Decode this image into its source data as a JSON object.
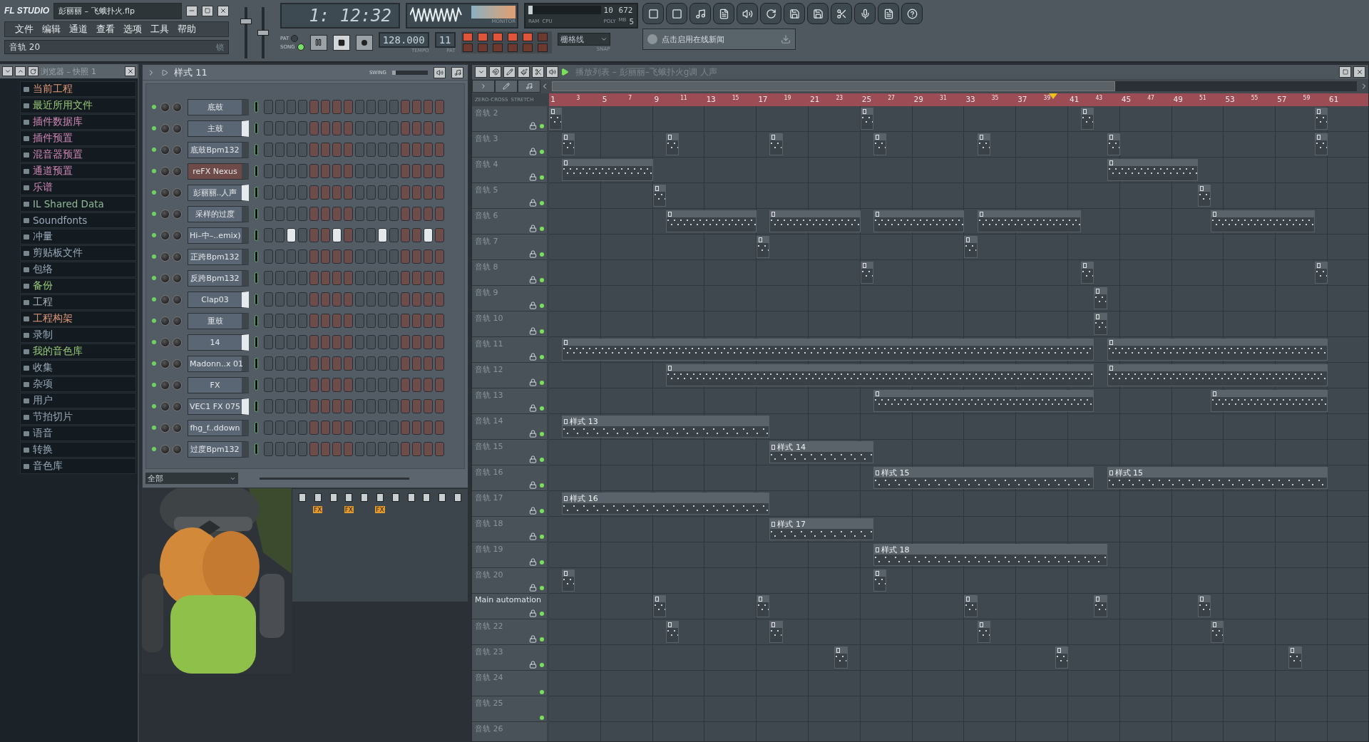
{
  "main_panel": {
    "logo": "FL STUDIO",
    "title": "彭丽丽 – 飞蛾扑火.flp",
    "menu": [
      "文件",
      "编辑",
      "通道",
      "查看",
      "选项",
      "工具",
      "帮助"
    ],
    "hint": "音轨 20",
    "hint_lock": "锁"
  },
  "master": {
    "volume": {
      "level": 0.75
    },
    "pitch": {
      "level": 0.5
    }
  },
  "transport": {
    "time": "1: 12:32",
    "modes": [
      {
        "label": "PAT",
        "selected": false
      },
      {
        "label": "SONG",
        "selected": true
      }
    ],
    "buttons": [
      {
        "kind": "pause",
        "pressed": false
      },
      {
        "kind": "stop",
        "pressed": true
      },
      {
        "kind": "record",
        "pressed": false
      }
    ],
    "tempo": "128.000",
    "tempo_label": "TEMPO",
    "pattern": "11",
    "pattern_label": "PAT"
  },
  "monitor": {
    "label": "MONITOR"
  },
  "cpu": {
    "cpu_value": "10",
    "ram_value": "672",
    "ram_label": "RAM",
    "mb_label": "MB",
    "cpu_label": "CPU",
    "poly_label": "POLY",
    "poly_value": "5"
  },
  "toggles": [
    {
      "on": true
    },
    {
      "on": true
    },
    {
      "on": true
    },
    {
      "on": true
    },
    {
      "on": true
    },
    {
      "on": false
    },
    {
      "on": false
    },
    {
      "on": false
    },
    {
      "on": false
    },
    {
      "on": false
    },
    {
      "on": false
    },
    {
      "on": false
    }
  ],
  "snap": {
    "value": "栅格线",
    "label": "SNAP"
  },
  "news": {
    "text": "点击启用在线新闻"
  },
  "browser": {
    "title": "浏览器 – 快照 1",
    "items": [
      {
        "label": "当前工程",
        "color": "#e09878"
      },
      {
        "label": "最近所用文件",
        "color": "#98c878"
      },
      {
        "label": "插件数据库",
        "color": "#d088b8"
      },
      {
        "label": "插件预置",
        "color": "#d088b8"
      },
      {
        "label": "混音器预置",
        "color": "#d088b8"
      },
      {
        "label": "通道预置",
        "color": "#d088b8"
      },
      {
        "label": "乐谱",
        "color": "#d088b8"
      },
      {
        "label": "IL Shared Data",
        "color": "#90b898"
      },
      {
        "label": "Soundfonts",
        "color": "#98a8b8"
      },
      {
        "label": "冲量",
        "color": "#98a8b8"
      },
      {
        "label": "剪贴板文件",
        "color": "#98a8b8"
      },
      {
        "label": "包络",
        "color": "#98a8b8"
      },
      {
        "label": "备份",
        "color": "#98c878"
      },
      {
        "label": "工程",
        "color": "#a8b0b8"
      },
      {
        "label": "工程构架",
        "color": "#e09878"
      },
      {
        "label": "录制",
        "color": "#98a8b8"
      },
      {
        "label": "我的音色库",
        "color": "#98c878"
      },
      {
        "label": "收集",
        "color": "#98a8b8"
      },
      {
        "label": "杂项",
        "color": "#98a8b8"
      },
      {
        "label": "用户",
        "color": "#98a8b8"
      },
      {
        "label": "节拍切片",
        "color": "#98a8b8"
      },
      {
        "label": "语音",
        "color": "#98a8b8"
      },
      {
        "label": "转换",
        "color": "#98a8b8"
      },
      {
        "label": "音色库",
        "color": "#98a8b8"
      }
    ]
  },
  "channel_rack": {
    "pattern": "样式 11",
    "swing_label": "SWING",
    "swing": {
      "level": 0.1
    },
    "filter": "全部",
    "channels": [
      {
        "name": "底鼓",
        "color": "#5b6674",
        "selected": false,
        "steps": [
          false,
          false,
          false,
          false,
          false,
          false,
          false,
          false,
          false,
          false,
          false,
          false,
          false,
          false,
          false,
          false
        ]
      },
      {
        "name": "主鼓",
        "color": "#5b6674",
        "selected": true,
        "steps": [
          false,
          false,
          false,
          false,
          false,
          false,
          false,
          false,
          false,
          false,
          false,
          false,
          false,
          false,
          false,
          false
        ]
      },
      {
        "name": "底鼓Bpm132",
        "color": "#5b6674",
        "selected": false,
        "steps": [
          false,
          false,
          false,
          false,
          false,
          false,
          false,
          false,
          false,
          false,
          false,
          false,
          false,
          false,
          false,
          false
        ]
      },
      {
        "name": "reFX Nexus",
        "color": "#6e4a48",
        "selected": false,
        "steps": [
          false,
          false,
          false,
          false,
          false,
          false,
          false,
          false,
          false,
          false,
          false,
          false,
          false,
          false,
          false,
          false
        ]
      },
      {
        "name": "彭丽丽..人声",
        "color": "#5b6674",
        "selected": true,
        "steps": [
          false,
          false,
          false,
          false,
          false,
          false,
          false,
          false,
          false,
          false,
          false,
          false,
          false,
          false,
          false,
          false
        ]
      },
      {
        "name": "采样的过度",
        "color": "#5b6674",
        "selected": false,
        "steps": [
          false,
          false,
          false,
          false,
          false,
          false,
          false,
          false,
          false,
          false,
          false,
          false,
          false,
          false,
          false,
          false
        ]
      },
      {
        "name": "Hi–中–..emix)",
        "color": "#5b6674",
        "selected": false,
        "steps": [
          false,
          false,
          true,
          false,
          false,
          false,
          true,
          false,
          false,
          false,
          true,
          false,
          false,
          false,
          true,
          false
        ]
      },
      {
        "name": "正跨Bpm132",
        "color": "#5b6674",
        "selected": false,
        "steps": [
          false,
          false,
          false,
          false,
          false,
          false,
          false,
          false,
          false,
          false,
          false,
          false,
          false,
          false,
          false,
          false
        ]
      },
      {
        "name": "反跨Bpm132",
        "color": "#5b6674",
        "selected": false,
        "steps": [
          false,
          false,
          false,
          false,
          false,
          false,
          false,
          false,
          false,
          false,
          false,
          false,
          false,
          false,
          false,
          false
        ]
      },
      {
        "name": "Clap03",
        "color": "#5b6674",
        "selected": true,
        "steps": [
          false,
          false,
          false,
          false,
          false,
          false,
          false,
          false,
          false,
          false,
          false,
          false,
          false,
          false,
          false,
          false
        ]
      },
      {
        "name": "重鼓",
        "color": "#5b6674",
        "selected": false,
        "steps": [
          false,
          false,
          false,
          false,
          false,
          false,
          false,
          false,
          false,
          false,
          false,
          false,
          false,
          false,
          false,
          false
        ]
      },
      {
        "name": "14",
        "color": "#5b6674",
        "selected": true,
        "steps": [
          false,
          false,
          false,
          false,
          false,
          false,
          false,
          false,
          false,
          false,
          false,
          false,
          false,
          false,
          false,
          false
        ]
      },
      {
        "name": "Madonn..x 01",
        "color": "#5b6674",
        "selected": false,
        "steps": [
          false,
          false,
          false,
          false,
          false,
          false,
          false,
          false,
          false,
          false,
          false,
          false,
          false,
          false,
          false,
          false
        ]
      },
      {
        "name": "FX",
        "color": "#5b6674",
        "selected": false,
        "steps": [
          false,
          false,
          false,
          false,
          false,
          false,
          false,
          false,
          false,
          false,
          false,
          false,
          false,
          false,
          false,
          false
        ]
      },
      {
        "name": "VEC1 FX 075",
        "color": "#5b6674",
        "selected": true,
        "steps": [
          false,
          false,
          false,
          false,
          false,
          false,
          false,
          false,
          false,
          false,
          false,
          false,
          false,
          false,
          false,
          false
        ]
      },
      {
        "name": "fhg_f..ddown",
        "color": "#5b6674",
        "selected": false,
        "steps": [
          false,
          false,
          false,
          false,
          false,
          false,
          false,
          false,
          false,
          false,
          false,
          false,
          false,
          false,
          false,
          false
        ]
      },
      {
        "name": "过度Bpm132",
        "color": "#5b6674",
        "selected": false,
        "steps": [
          false,
          false,
          false,
          false,
          false,
          false,
          false,
          false,
          false,
          false,
          false,
          false,
          false,
          false,
          false,
          false
        ]
      }
    ]
  },
  "mixer": {
    "strips": [
      {
        "kind": "plain"
      },
      {
        "kind": "fx",
        "fx_label": "FX"
      },
      {
        "kind": "plain"
      },
      {
        "kind": "fx",
        "fx_label": "FX"
      },
      {
        "kind": "plain"
      },
      {
        "kind": "fx",
        "fx_label": "FX"
      },
      {
        "kind": "plain"
      },
      {
        "kind": "plain"
      },
      {
        "kind": "plain"
      },
      {
        "kind": "plain"
      },
      {
        "kind": "plain"
      }
    ]
  },
  "playlist": {
    "title": "播放列表 – 彭丽丽–飞蛾扑火g调 人声",
    "zero_cross": "ZERO-CROSS",
    "stretch": "STRETCH",
    "ruler": [
      "1",
      "3",
      "5",
      "7",
      "9",
      "11",
      "13",
      "15",
      "17",
      "19",
      "21",
      "23",
      "25",
      "27",
      "29",
      "31",
      "33",
      "35",
      "37",
      "39",
      "41",
      "43",
      "45",
      "47",
      "49",
      "51",
      "53",
      "55",
      "57",
      "59",
      "61"
    ],
    "tracks": [
      {
        "name": "音轨 2",
        "lock": true,
        "clips": [
          {
            "kind": "notes"
          },
          {
            "kind": "notes"
          },
          {
            "kind": "notes"
          },
          {
            "kind": "notes"
          }
        ]
      },
      {
        "name": "音轨 3",
        "lock": true,
        "clips": [
          {
            "kind": "notes"
          },
          {
            "kind": "notes"
          },
          {
            "kind": "notes"
          },
          {
            "kind": "notes"
          },
          {
            "kind": "notes"
          },
          {
            "kind": "notes"
          },
          {
            "kind": "notes"
          }
        ]
      },
      {
        "name": "音轨 4",
        "lock": true,
        "clips": [
          {
            "kind": "notes"
          },
          {
            "kind": "notes"
          }
        ]
      },
      {
        "name": "音轨 5",
        "lock": true,
        "clips": [
          {
            "kind": "notes"
          },
          {
            "kind": "notes"
          }
        ]
      },
      {
        "name": "音轨 6",
        "lock": true,
        "clips": [
          {
            "kind": "notes"
          },
          {
            "kind": "notes"
          },
          {
            "kind": "notes"
          },
          {
            "kind": "notes"
          },
          {
            "kind": "notes"
          }
        ]
      },
      {
        "name": "音轨 7",
        "lock": true,
        "clips": [
          {
            "kind": "notes"
          },
          {
            "kind": "notes"
          }
        ]
      },
      {
        "name": "音轨 8",
        "lock": true,
        "clips": [
          {
            "kind": "notes"
          },
          {
            "kind": "notes"
          },
          {
            "kind": "notes"
          }
        ]
      },
      {
        "name": "音轨 9",
        "lock": true,
        "clips": [
          {
            "kind": "notes"
          }
        ]
      },
      {
        "name": "音轨 10",
        "lock": true,
        "clips": [
          {
            "kind": "notes"
          }
        ]
      },
      {
        "name": "音轨 11",
        "lock": true,
        "clips": [
          {
            "kind": "notes"
          },
          {
            "kind": "notes"
          }
        ]
      },
      {
        "name": "音轨 12",
        "lock": true,
        "clips": [
          {
            "kind": "notes"
          },
          {
            "kind": "notes"
          }
        ]
      },
      {
        "name": "音轨 13",
        "lock": true,
        "clips": [
          {
            "kind": "notes"
          },
          {
            "kind": "notes"
          }
        ]
      },
      {
        "name": "音轨 14",
        "lock": true,
        "clips": [
          {
            "kind": "pattern",
            "label": "样式 13"
          }
        ]
      },
      {
        "name": "音轨 15",
        "lock": true,
        "clips": [
          {
            "kind": "pattern",
            "label": "样式 14"
          }
        ]
      },
      {
        "name": "音轨 16",
        "lock": true,
        "clips": [
          {
            "kind": "pattern",
            "label": "样式 15"
          },
          {
            "kind": "pattern",
            "label": "样式 15"
          }
        ]
      },
      {
        "name": "音轨 17",
        "lock": true,
        "clips": [
          {
            "kind": "pattern",
            "label": "样式 16"
          }
        ]
      },
      {
        "name": "音轨 18",
        "lock": true,
        "clips": [
          {
            "kind": "pattern",
            "label": "样式 17"
          }
        ]
      },
      {
        "name": "音轨 19",
        "lock": true,
        "clips": [
          {
            "kind": "pattern",
            "label": "样式 18"
          }
        ]
      },
      {
        "name": "音轨 20",
        "lock": true,
        "clips": [
          {
            "kind": "notes"
          },
          {
            "kind": "notes"
          }
        ]
      },
      {
        "name": "Main automation",
        "lock": true,
        "clips": [
          {
            "kind": "notes"
          },
          {
            "kind": "notes"
          },
          {
            "kind": "notes"
          },
          {
            "kind": "notes"
          },
          {
            "kind": "notes"
          }
        ]
      },
      {
        "name": "音轨 22",
        "lock": true,
        "clips": [
          {
            "kind": "notes"
          },
          {
            "kind": "notes"
          },
          {
            "kind": "notes"
          },
          {
            "kind": "notes"
          }
        ]
      },
      {
        "name": "音轨 23",
        "lock": true,
        "clips": [
          {
            "kind": "notes"
          },
          {
            "kind": "notes"
          },
          {
            "kind": "notes"
          }
        ]
      },
      {
        "name": "音轨 24",
        "lock": false
      },
      {
        "name": "音轨 25",
        "lock": false
      },
      {
        "name": "音轨 26"
      }
    ]
  }
}
